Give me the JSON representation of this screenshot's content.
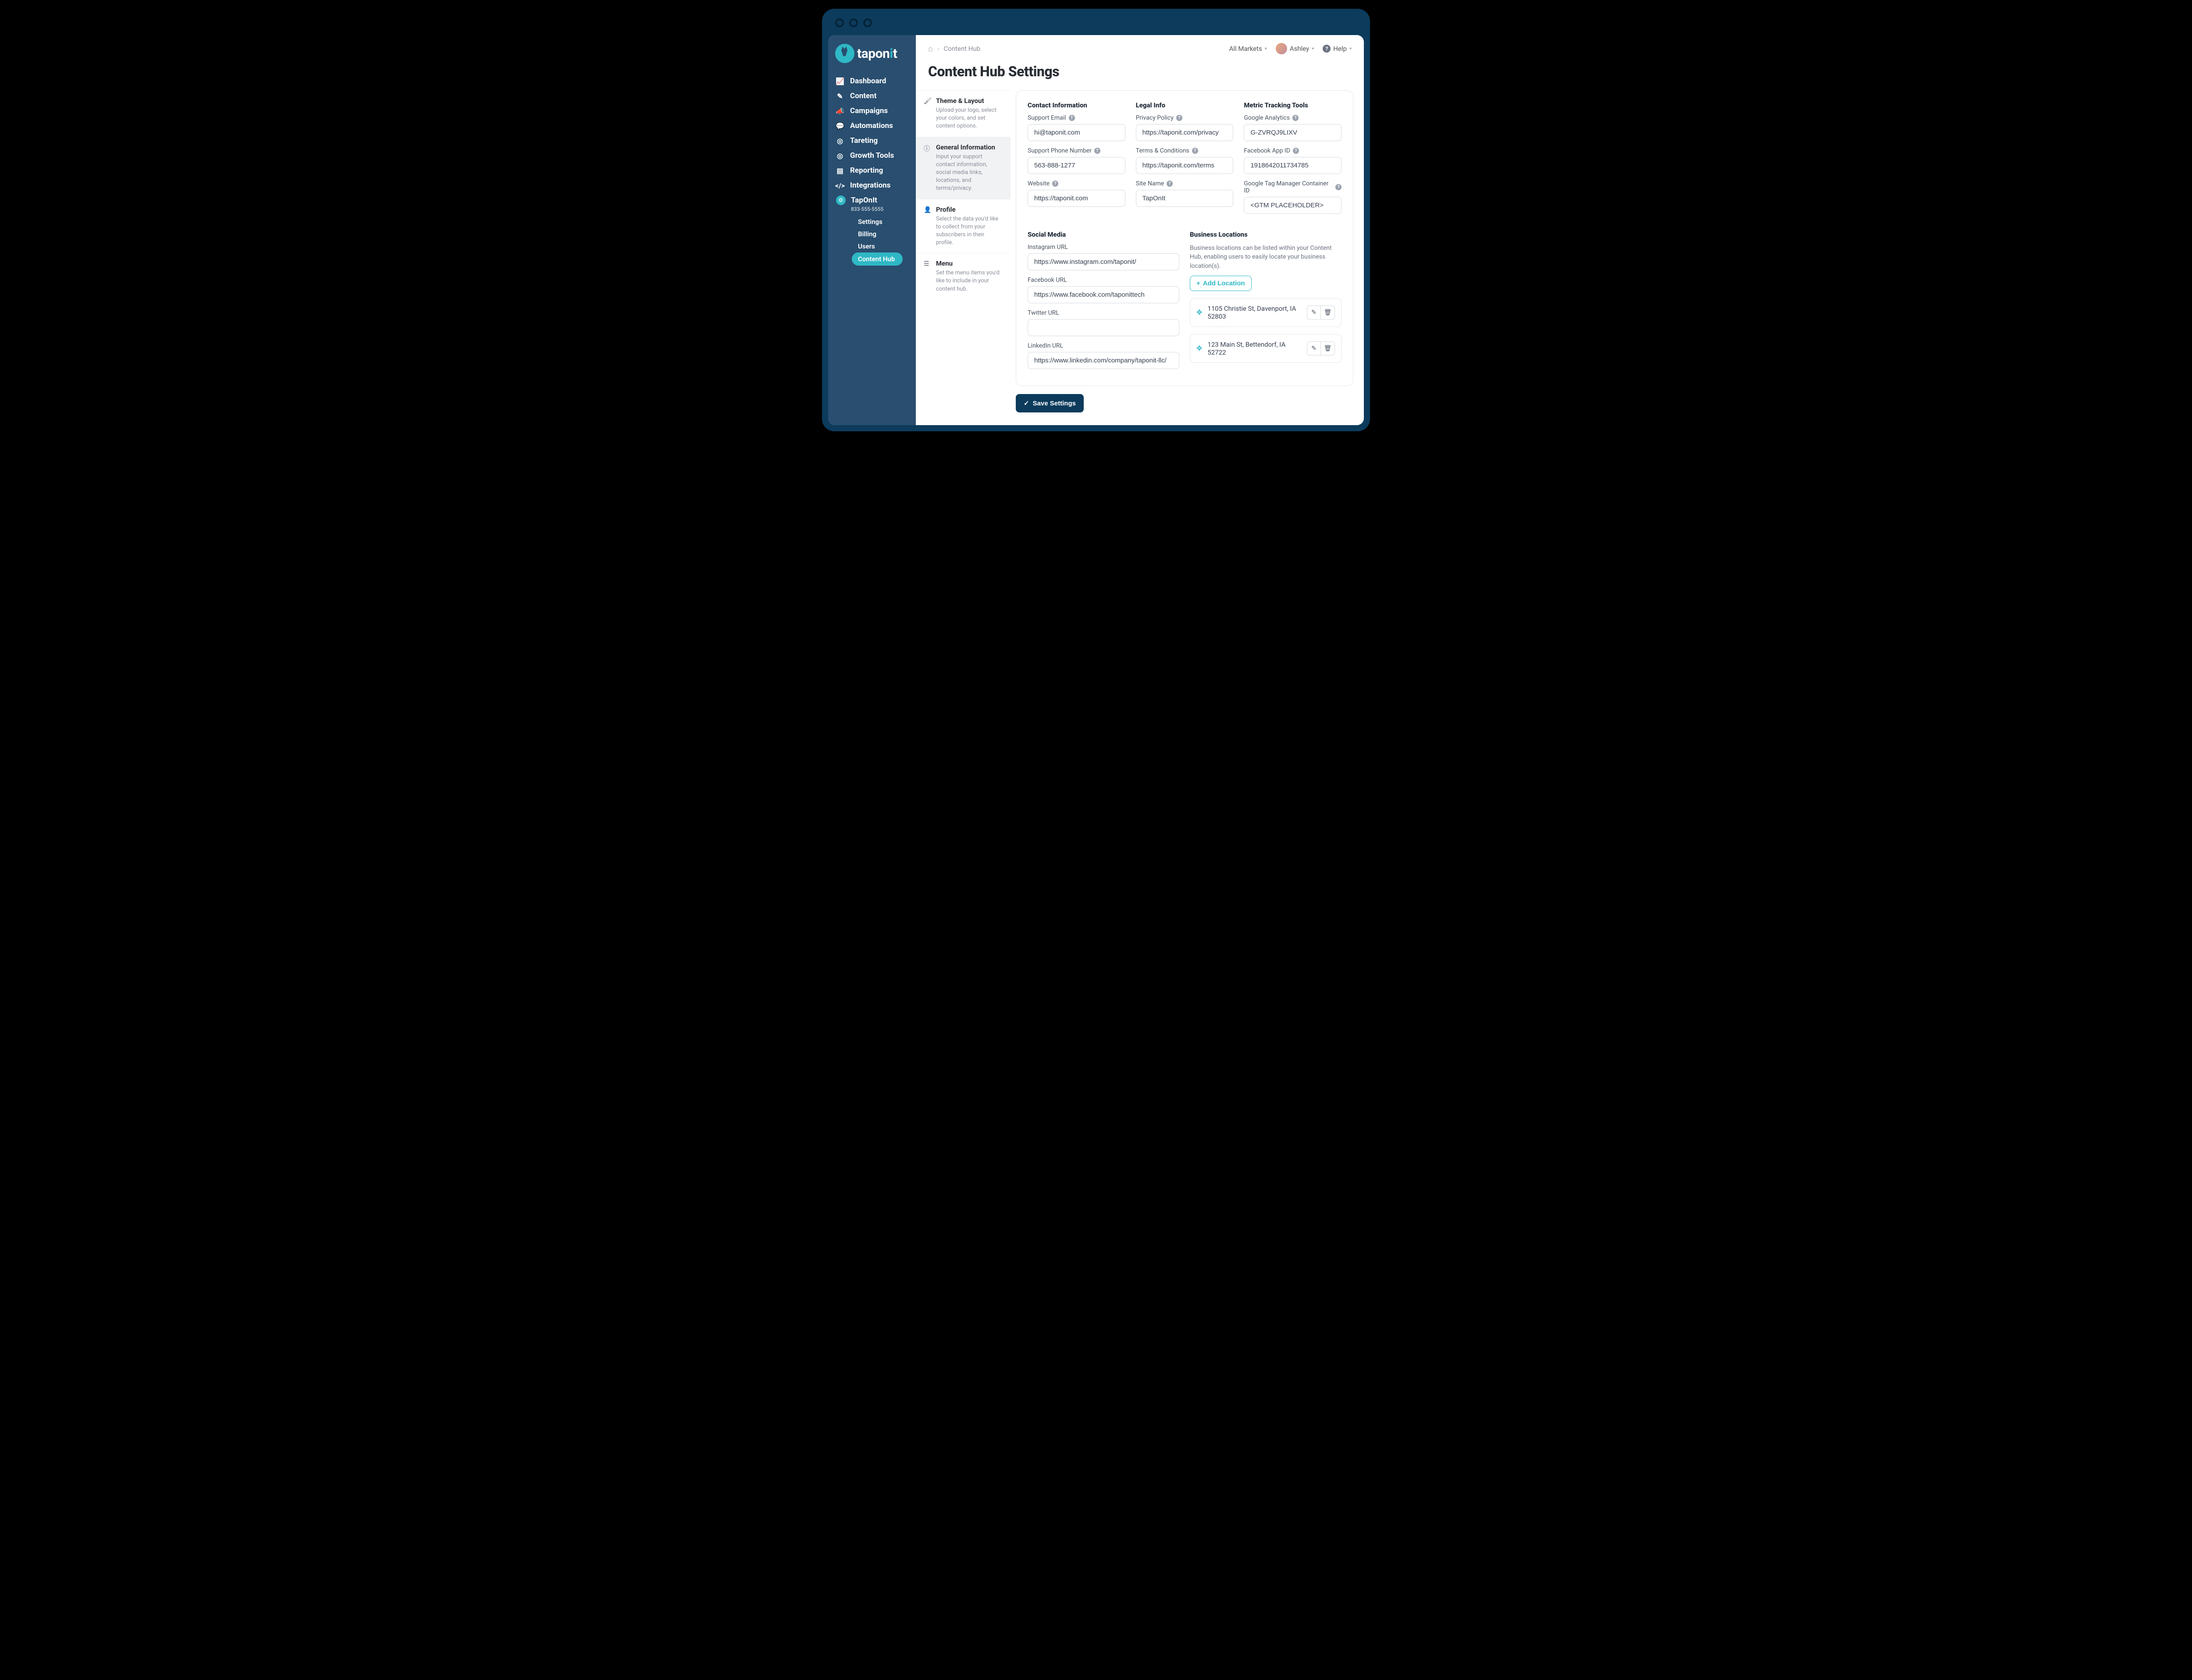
{
  "brand": {
    "name": "taponit"
  },
  "nav": {
    "items": [
      {
        "label": "Dashboard"
      },
      {
        "label": "Content"
      },
      {
        "label": "Campaigns"
      },
      {
        "label": "Automations"
      },
      {
        "label": "Tareting"
      },
      {
        "label": "Growth Tools"
      },
      {
        "label": "Reporting"
      },
      {
        "label": "Integrations"
      }
    ],
    "account": {
      "name": "TapOnIt",
      "phone": "833-555-5555"
    },
    "subnav": [
      {
        "label": "Settings"
      },
      {
        "label": "Billing"
      },
      {
        "label": "Users"
      },
      {
        "label": "Content Hub"
      }
    ]
  },
  "breadcrumb": {
    "current": "Content Hub"
  },
  "topbar": {
    "markets": "All Markets",
    "user": "Ashley",
    "help": "Help"
  },
  "page": {
    "title": "Content Hub Settings"
  },
  "secondaryNav": [
    {
      "title": "Theme & Layout",
      "desc": "Upload your logo, select your colors, and set content options."
    },
    {
      "title": "General Information",
      "desc": "Input your support contact information, social media links, locations, and terms/privacy."
    },
    {
      "title": "Profile",
      "desc": "Select the data you'd like to collect from your subscribers in their profile."
    },
    {
      "title": "Menu",
      "desc": "Set the menu items you'd like to include in your content hub."
    }
  ],
  "sections": {
    "contact": {
      "title": "Contact Information",
      "emailLabel": "Support Email",
      "email": "hi@taponit.com",
      "phoneLabel": "Support Phone Number",
      "phone": "563-888-1277",
      "websiteLabel": "Website",
      "website": "https://taponit.com"
    },
    "legal": {
      "title": "Legal Info",
      "privacyLabel": "Privacy Policy",
      "privacy": "https://taponit.com/privacy",
      "termsLabel": "Terms & Conditions",
      "terms": "https://taponit.com/terms",
      "siteNameLabel": "Site Name",
      "siteName": "TapOnIt"
    },
    "metrics": {
      "title": "Metric Tracking Tools",
      "gaLabel": "Google Analytics",
      "ga": "G-ZVRQJ9LIXV",
      "fbLabel": "Facebook App ID",
      "fb": "1918642011734785",
      "gtmLabel": "Google Tag Manager Container ID",
      "gtm": "<GTM PLACEHOLDER>"
    },
    "social": {
      "title": "Social Media",
      "igLabel": "Instagram URL",
      "ig": "https://www.instagram.com/taponit/",
      "fbLabel": "Facebook URL",
      "fb": "https://www.facebook.com/taponittech",
      "twLabel": "Twitter URL",
      "tw": "",
      "liLabel": "LinkedIn URL",
      "li": "https://www.linkedin.com/company/taponit-llc/"
    },
    "locations": {
      "title": "Business Locations",
      "desc": "Business locations can be listed within your Content Hub, enabling users to easily locate your business location(s).",
      "addLabel": "Add Location",
      "items": [
        {
          "address": "1105 Christie St, Davenport, IA 52803"
        },
        {
          "address": "123 Main St, Bettendorf, IA 52722"
        }
      ]
    }
  },
  "actions": {
    "save": "Save Settings"
  }
}
